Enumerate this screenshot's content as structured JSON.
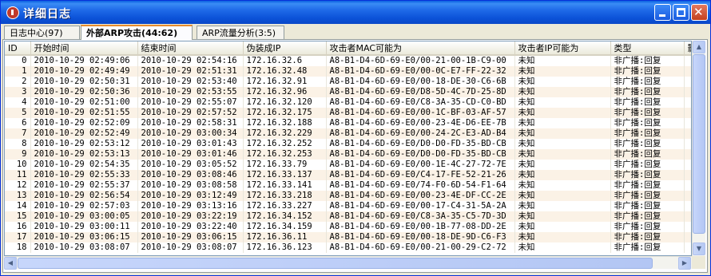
{
  "window": {
    "title": "详细日志"
  },
  "tabs": [
    {
      "label": "日志中心(97)"
    },
    {
      "label": "外部ARP攻击(44:62)"
    },
    {
      "label": "ARP流量分析(3:5)"
    }
  ],
  "table": {
    "columns": [
      "ID",
      "开始时间",
      "结束时间",
      "伪装成IP",
      "攻击者MAC可能为",
      "攻击者IP可能为",
      "类型",
      "影"
    ],
    "rows": [
      [
        "0",
        "2010-10-29 02:49:06",
        "2010-10-29 02:54:16",
        "172.16.32.6",
        "A8-B1-D4-6D-69-E0/00-21-00-1B-C9-00",
        "未知",
        "非广播:回复"
      ],
      [
        "1",
        "2010-10-29 02:49:49",
        "2010-10-29 02:51:31",
        "172.16.32.48",
        "A8-B1-D4-6D-69-E0/00-0C-E7-FF-22-32",
        "未知",
        "非广播:回复"
      ],
      [
        "2",
        "2010-10-29 02:50:31",
        "2010-10-29 02:53:40",
        "172.16.32.91",
        "A8-B1-D4-6D-69-E0/00-18-DE-30-C6-6B",
        "未知",
        "非广播:回复"
      ],
      [
        "3",
        "2010-10-29 02:50:36",
        "2010-10-29 02:53:55",
        "172.16.32.96",
        "A8-B1-D4-6D-69-E0/D8-5D-4C-7D-25-8D",
        "未知",
        "非广播:回复"
      ],
      [
        "4",
        "2010-10-29 02:51:00",
        "2010-10-29 02:55:07",
        "172.16.32.120",
        "A8-B1-D4-6D-69-E0/C8-3A-35-CD-C0-BD",
        "未知",
        "非广播:回复"
      ],
      [
        "5",
        "2010-10-29 02:51:55",
        "2010-10-29 02:57:52",
        "172.16.32.175",
        "A8-B1-D4-6D-69-E0/00-1C-BF-03-AF-57",
        "未知",
        "非广播:回复"
      ],
      [
        "6",
        "2010-10-29 02:52:09",
        "2010-10-29 02:58:31",
        "172.16.32.188",
        "A8-B1-D4-6D-69-E0/00-23-4E-D6-EE-7B",
        "未知",
        "非广播:回复"
      ],
      [
        "7",
        "2010-10-29 02:52:49",
        "2010-10-29 03:00:34",
        "172.16.32.229",
        "A8-B1-D4-6D-69-E0/00-24-2C-E3-AD-B4",
        "未知",
        "非广播:回复"
      ],
      [
        "8",
        "2010-10-29 02:53:12",
        "2010-10-29 03:01:43",
        "172.16.32.252",
        "A8-B1-D4-6D-69-E0/D0-D0-FD-35-BD-CB",
        "未知",
        "非广播:回复"
      ],
      [
        "9",
        "2010-10-29 02:53:13",
        "2010-10-29 03:01:46",
        "172.16.32.253",
        "A8-B1-D4-6D-69-E0/D0-D0-FD-35-BD-CB",
        "未知",
        "非广播:回复"
      ],
      [
        "10",
        "2010-10-29 02:54:35",
        "2010-10-29 03:05:52",
        "172.16.33.79",
        "A8-B1-D4-6D-69-E0/00-1E-4C-27-72-7E",
        "未知",
        "非广播:回复"
      ],
      [
        "11",
        "2010-10-29 02:55:33",
        "2010-10-29 03:08:46",
        "172.16.33.137",
        "A8-B1-D4-6D-69-E0/C4-17-FE-52-21-26",
        "未知",
        "非广播:回复"
      ],
      [
        "12",
        "2010-10-29 02:55:37",
        "2010-10-29 03:08:58",
        "172.16.33.141",
        "A8-B1-D4-6D-69-E0/74-F0-6D-54-F1-64",
        "未知",
        "非广播:回复"
      ],
      [
        "13",
        "2010-10-29 02:56:54",
        "2010-10-29 03:12:49",
        "172.16.33.218",
        "A8-B1-D4-6D-69-E0/00-23-4E-DF-CC-2E",
        "未知",
        "非广播:回复"
      ],
      [
        "14",
        "2010-10-29 02:57:03",
        "2010-10-29 03:13:16",
        "172.16.33.227",
        "A8-B1-D4-6D-69-E0/00-17-C4-31-5A-2A",
        "未知",
        "非广播:回复"
      ],
      [
        "15",
        "2010-10-29 03:00:05",
        "2010-10-29 03:22:19",
        "172.16.34.152",
        "A8-B1-D4-6D-69-E0/C8-3A-35-C5-7D-3D",
        "未知",
        "非广播:回复"
      ],
      [
        "16",
        "2010-10-29 03:00:11",
        "2010-10-29 03:22:40",
        "172.16.34.159",
        "A8-B1-D4-6D-69-E0/00-1B-77-08-DD-2E",
        "未知",
        "非广播:回复"
      ],
      [
        "17",
        "2010-10-29 03:06:15",
        "2010-10-29 03:06:15",
        "172.16.36.11",
        "A8-B1-D4-6D-69-E0/00-18-DE-9D-C6-F3",
        "未知",
        "非广播:回复"
      ],
      [
        "18",
        "2010-10-29 03:08:07",
        "2010-10-29 03:08:07",
        "172.16.36.123",
        "A8-B1-D4-6D-69-E0/00-21-00-29-C2-72",
        "未知",
        "非广播:回复"
      ]
    ]
  },
  "icons": {
    "title": "shield-icon",
    "minimize": "minimize-icon",
    "maximize": "maximize-icon",
    "close": "close-icon"
  }
}
